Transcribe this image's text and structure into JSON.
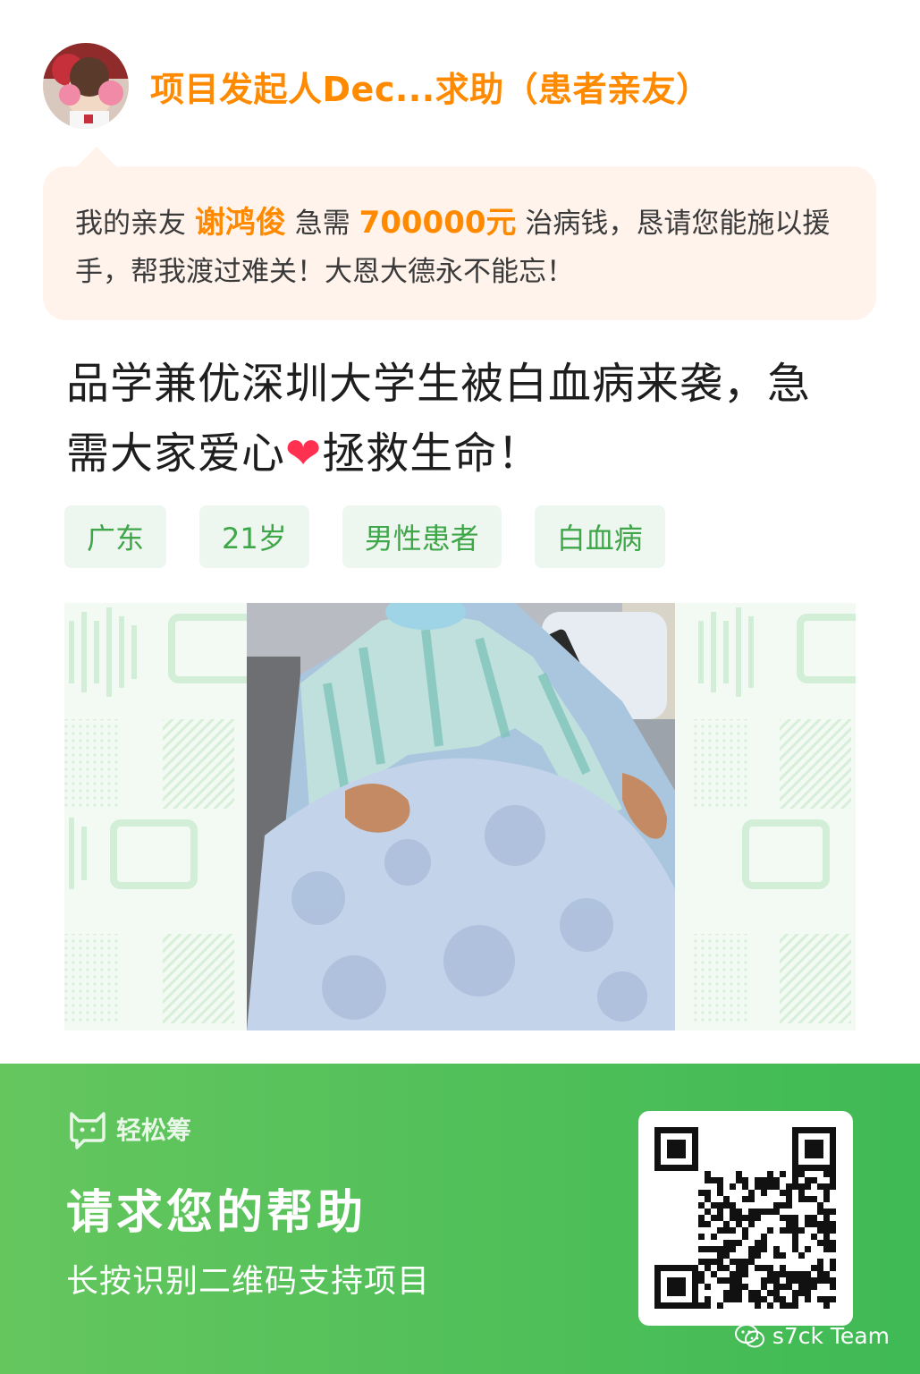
{
  "header": {
    "title": "项目发起人Dec...求助（患者亲友）"
  },
  "appeal": {
    "prefix": "我的亲友 ",
    "name": "谢鸿俊",
    "mid": " 急需 ",
    "amount": "700000元",
    "suffix": " 治病钱，恳请您能施以援手，帮我渡过难关！大恩大德永不能忘！"
  },
  "headline": {
    "before_heart": "品学兼优深圳大学生被白血病来袭，急需大家爱心",
    "heart": "❤",
    "after_heart": "拯救生命！"
  },
  "tags": [
    "广东",
    "21岁",
    "男性患者",
    "白血病"
  ],
  "footer": {
    "brand": "轻松筹",
    "title": "请求您的帮助",
    "subtitle": "长按识别二维码支持项目",
    "watermark": "s7ck Team"
  },
  "colors": {
    "accent_orange": "#ff8a00",
    "brand_green": "#4fc15a",
    "tag_bg": "#eef7ef",
    "bubble_bg": "#fff3ec"
  }
}
